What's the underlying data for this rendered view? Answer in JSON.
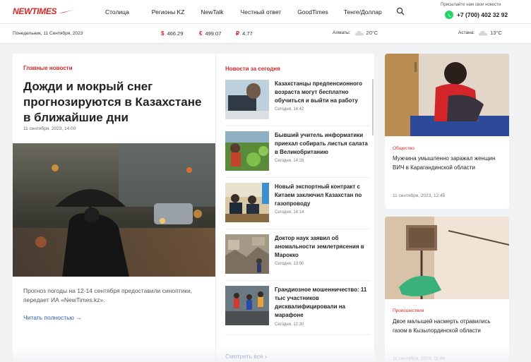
{
  "header": {
    "logo_text": "NEWTIMES",
    "nav": [
      "Столица",
      "Регионы KZ",
      "NewTalk",
      "Честный ответ",
      "GoodTimes",
      "Тенге/Доллар"
    ],
    "send_news_label": "Присылайте нам свои новости",
    "phone": "+7 (700) 402 32 92"
  },
  "infobar": {
    "date": "Понедельник, 11 Сентября, 2023",
    "rates": [
      {
        "symbol": "$",
        "value": "466.29"
      },
      {
        "symbol": "€",
        "value": "499.07"
      },
      {
        "symbol": "₽",
        "value": "4.77"
      }
    ],
    "weather": [
      {
        "city": "Алматы:",
        "temp": "20°C"
      },
      {
        "city": "Астана:",
        "temp": "13°C"
      }
    ]
  },
  "main": {
    "section_label": "Главные новости",
    "headline": "Дожди и мокрый снег прогнозируются в Казахстане в ближайшие дни",
    "date": "11 сентября, 2023, 14:00",
    "summary": "Прогноз погоды на 12-14 сентября предоставили синоптики, передает ИА «NewTimes.kz».",
    "read_more": "Читать полностью →"
  },
  "today": {
    "section_label": "Новости за сегодня",
    "items": [
      {
        "title": "Казахстанцы предпенсионного возраста могут бесплатно обучиться и выйти на работу",
        "time": "Сегодня, 14:42"
      },
      {
        "title": "Бывший учитель информатики приехал собирать листья салата в Великобританию",
        "time": "Сегодня, 14:28"
      },
      {
        "title": "Новый экспортный контракт с Китаем заключил Казахстан по газопроводу",
        "time": "Сегодня, 14:14"
      },
      {
        "title": "Доктор наук заявил об аномальности землетрясения в Марокко",
        "time": "Сегодня, 13:00"
      },
      {
        "title": "Грандиозное мошенничество: 11 тыс участников дисквалифицировали на марафоне",
        "time": "Сегодня, 12:30"
      }
    ],
    "see_all": "Смотреть все ›"
  },
  "side": [
    {
      "category": "Общество",
      "title": "Мужчина умышленно заражал женщин ВИЧ в Карагандинской области",
      "time": "11 сентября, 2023, 12:45"
    },
    {
      "category": "Происшествия",
      "title": "Двое малышей насмерть отравились газом в Кызылординской области",
      "time": "11 сентября, 2023, 11:48"
    }
  ],
  "colors": {
    "accent": "#d62828",
    "link": "#2a5bb8"
  }
}
